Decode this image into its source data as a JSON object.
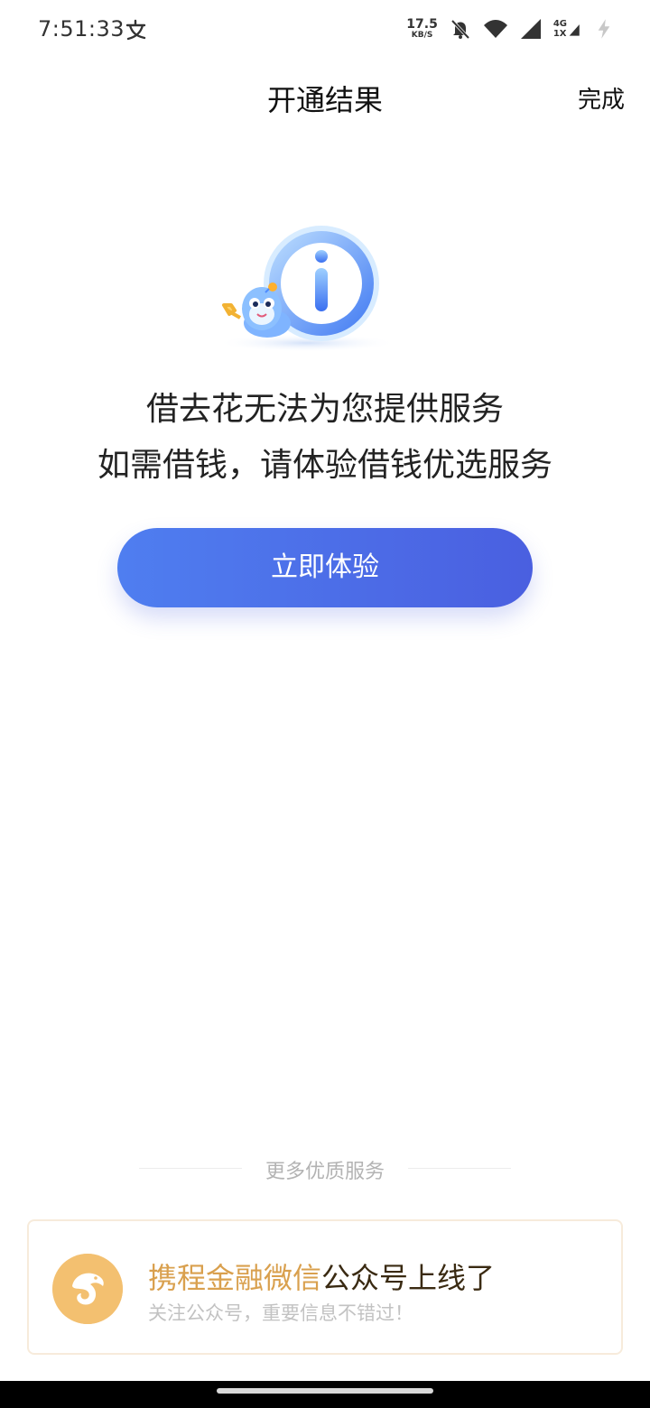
{
  "status_bar": {
    "time": "7:51:33",
    "net_speed_value": "17.5",
    "net_speed_unit": "KB/S",
    "network_top": "4G",
    "network_bottom": "1X"
  },
  "header": {
    "title": "开通结果",
    "done_label": "完成"
  },
  "main": {
    "message_line1": "借去花无法为您提供服务",
    "message_line2": "如需借钱，请体验借钱优选服务",
    "cta_label": "立即体验"
  },
  "more_services": {
    "label": "更多优质服务"
  },
  "promo": {
    "title_highlight": "携程金融微信",
    "title_rest": "公众号上线了",
    "subtitle": "关注公众号，重要信息不错过！"
  },
  "colors": {
    "accent_blue": "#4f7ef0",
    "accent_gold": "#d9a04e"
  },
  "icons": [
    "app-notification-icon",
    "mute-bell-icon",
    "wifi-icon",
    "signal-icon",
    "signal-secondary-icon",
    "charging-icon",
    "info-mascot-illustration",
    "dolphin-logo-icon"
  ]
}
